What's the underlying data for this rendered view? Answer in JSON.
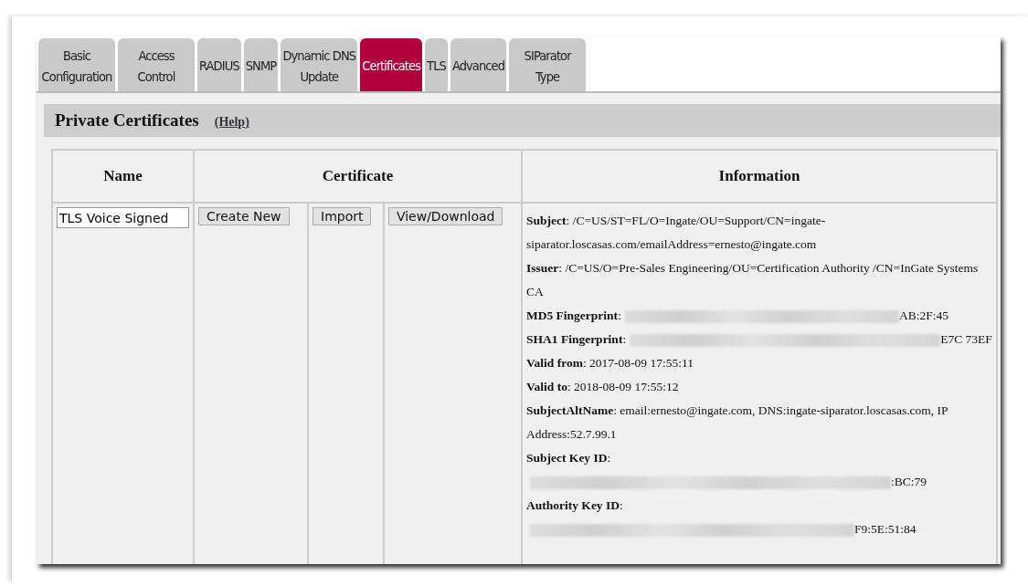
{
  "tabs": [
    {
      "label": "Basic Configuration",
      "selected": false
    },
    {
      "label": "Access Control",
      "selected": false
    },
    {
      "label": "RADIUS",
      "selected": false
    },
    {
      "label": "SNMP",
      "selected": false
    },
    {
      "label": "Dynamic DNS Update",
      "selected": false
    },
    {
      "label": "Certificates",
      "selected": true
    },
    {
      "label": "TLS",
      "selected": false
    },
    {
      "label": "Advanced",
      "selected": false
    },
    {
      "label": "SIParator Type",
      "selected": false
    }
  ],
  "section": {
    "title": "Private Certificates",
    "help_link": "(Help)"
  },
  "table": {
    "columns": [
      "Name",
      "Certificate",
      "Information"
    ],
    "rows": [
      {
        "name": {
          "value": "TLS Voice Signed"
        },
        "buttons": [
          "Create New",
          "Import",
          "View/Download"
        ],
        "information": [
          {
            "kind": "plain",
            "text": "**Subject**: /C=US/ST=FL/O=Ingate/OU=Support/CN=ingate-siparator.loscasas.com/emailAddress=ernesto@ingate.com"
          },
          {
            "kind": "plain",
            "text": "**Issuer**: /C=US/O=Pre-Sales Engineering/OU=Certification Authority /CN=InGate Systems CA"
          },
          {
            "kind": "redacted",
            "text": "**MD5 Fingerprint**:",
            "value": "AB:2F:45"
          },
          {
            "kind": "redacted",
            "text": "**SHA1 Fingerprint**:",
            "value": "E7C 73EF"
          },
          {
            "kind": "plain",
            "text": "**Valid from**: 2017-08-09 17:55:11"
          },
          {
            "kind": "plain",
            "text": "**Valid to**: 2018-08-09 17:55:12"
          },
          {
            "kind": "plain",
            "text": "**SubjectAltName**: email:ernesto@ingate.com,  DNS:ingate-siparator.loscasas.com,  IP Address:52.7.99.1"
          },
          {
            "kind": "redacted",
            "text": "**Subject Key ID**:",
            "value": ":BC:79"
          },
          {
            "kind": "redacted",
            "text": "**Authority Key ID**:",
            "value": "F9:5E:51:84"
          }
        ]
      }
    ]
  }
}
